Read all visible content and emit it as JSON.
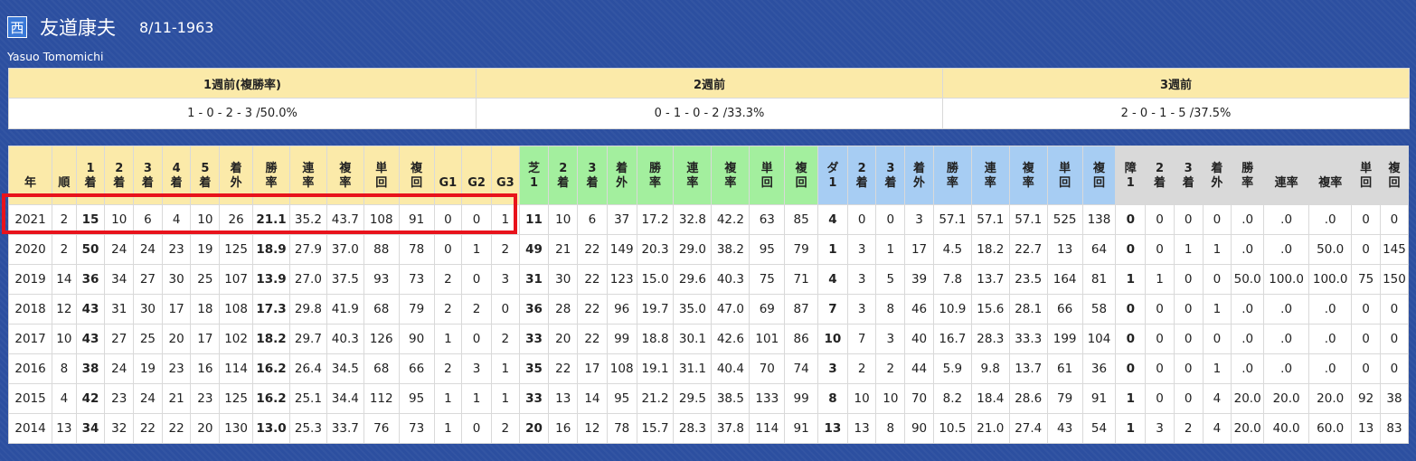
{
  "header": {
    "region_badge": "西",
    "name_jp": "友道康夫",
    "birthdate": "8/11-1963",
    "name_en": "Yasuo Tomomichi"
  },
  "recent": {
    "headers": [
      "1週前(複勝率)",
      "2週前",
      "3週前"
    ],
    "values": [
      "1 - 0 - 2 - 3 /50.0%",
      "0 - 1 - 0 - 2 /33.3%",
      "2 - 0 - 1 - 5 /37.5%"
    ]
  },
  "colors": {
    "background": "#2c4fa0",
    "header_yellow": "#fbeaa9",
    "turf_green": "#a3ef9e",
    "dirt_blue": "#a7cdf3",
    "jump_gray": "#d9d9d9",
    "highlight_red": "#e8131c"
  },
  "stats": {
    "columns": [
      {
        "l1": "",
        "l2": "年"
      },
      {
        "l1": "",
        "l2": "順"
      },
      {
        "l1": "1",
        "l2": "着"
      },
      {
        "l1": "2",
        "l2": "着"
      },
      {
        "l1": "3",
        "l2": "着"
      },
      {
        "l1": "4",
        "l2": "着"
      },
      {
        "l1": "5",
        "l2": "着"
      },
      {
        "l1": "着",
        "l2": "外"
      },
      {
        "l1": "勝",
        "l2": "率"
      },
      {
        "l1": "連",
        "l2": "率"
      },
      {
        "l1": "複",
        "l2": "率"
      },
      {
        "l1": "単",
        "l2": "回"
      },
      {
        "l1": "複",
        "l2": "回"
      },
      {
        "l1": "",
        "l2": "G1"
      },
      {
        "l1": "",
        "l2": "G2"
      },
      {
        "l1": "",
        "l2": "G3"
      },
      {
        "l1": "芝",
        "l2": "1"
      },
      {
        "l1": "2",
        "l2": "着"
      },
      {
        "l1": "3",
        "l2": "着"
      },
      {
        "l1": "着",
        "l2": "外"
      },
      {
        "l1": "勝",
        "l2": "率"
      },
      {
        "l1": "連",
        "l2": "率"
      },
      {
        "l1": "複",
        "l2": "率"
      },
      {
        "l1": "単",
        "l2": "回"
      },
      {
        "l1": "複",
        "l2": "回"
      },
      {
        "l1": "ダ",
        "l2": "1"
      },
      {
        "l1": "2",
        "l2": "着"
      },
      {
        "l1": "3",
        "l2": "着"
      },
      {
        "l1": "着",
        "l2": "外"
      },
      {
        "l1": "勝",
        "l2": "率"
      },
      {
        "l1": "連",
        "l2": "率"
      },
      {
        "l1": "複",
        "l2": "率"
      },
      {
        "l1": "単",
        "l2": "回"
      },
      {
        "l1": "複",
        "l2": "回"
      },
      {
        "l1": "障",
        "l2": "1"
      },
      {
        "l1": "2",
        "l2": "着"
      },
      {
        "l1": "3",
        "l2": "着"
      },
      {
        "l1": "着",
        "l2": "外"
      },
      {
        "l1": "勝",
        "l2": "率"
      },
      {
        "l1": "",
        "l2": "連率"
      },
      {
        "l1": "",
        "l2": "複率"
      },
      {
        "l1": "単",
        "l2": "回"
      },
      {
        "l1": "複",
        "l2": "回"
      }
    ],
    "rows": [
      [
        "2021",
        "2",
        "15",
        "10",
        "6",
        "4",
        "10",
        "26",
        "21.1",
        "35.2",
        "43.7",
        "108",
        "91",
        "0",
        "0",
        "1",
        "11",
        "10",
        "6",
        "37",
        "17.2",
        "32.8",
        "42.2",
        "63",
        "85",
        "4",
        "0",
        "0",
        "3",
        "57.1",
        "57.1",
        "57.1",
        "525",
        "138",
        "0",
        "0",
        "0",
        "0",
        ".0",
        ".0",
        ".0",
        "0",
        "0"
      ],
      [
        "2020",
        "2",
        "50",
        "24",
        "24",
        "23",
        "19",
        "125",
        "18.9",
        "27.9",
        "37.0",
        "88",
        "78",
        "0",
        "1",
        "2",
        "49",
        "21",
        "22",
        "149",
        "20.3",
        "29.0",
        "38.2",
        "95",
        "79",
        "1",
        "3",
        "1",
        "17",
        "4.5",
        "18.2",
        "22.7",
        "13",
        "64",
        "0",
        "0",
        "1",
        "1",
        ".0",
        ".0",
        "50.0",
        "0",
        "145"
      ],
      [
        "2019",
        "14",
        "36",
        "34",
        "27",
        "30",
        "25",
        "107",
        "13.9",
        "27.0",
        "37.5",
        "93",
        "73",
        "2",
        "0",
        "3",
        "31",
        "30",
        "22",
        "123",
        "15.0",
        "29.6",
        "40.3",
        "75",
        "71",
        "4",
        "3",
        "5",
        "39",
        "7.8",
        "13.7",
        "23.5",
        "164",
        "81",
        "1",
        "1",
        "0",
        "0",
        "50.0",
        "100.0",
        "100.0",
        "75",
        "150"
      ],
      [
        "2018",
        "12",
        "43",
        "31",
        "30",
        "17",
        "18",
        "108",
        "17.3",
        "29.8",
        "41.9",
        "68",
        "79",
        "2",
        "2",
        "0",
        "36",
        "28",
        "22",
        "96",
        "19.7",
        "35.0",
        "47.0",
        "69",
        "87",
        "7",
        "3",
        "8",
        "46",
        "10.9",
        "15.6",
        "28.1",
        "66",
        "58",
        "0",
        "0",
        "0",
        "1",
        ".0",
        ".0",
        ".0",
        "0",
        "0"
      ],
      [
        "2017",
        "10",
        "43",
        "27",
        "25",
        "20",
        "17",
        "102",
        "18.2",
        "29.7",
        "40.3",
        "126",
        "90",
        "1",
        "0",
        "2",
        "33",
        "20",
        "22",
        "99",
        "18.8",
        "30.1",
        "42.6",
        "101",
        "86",
        "10",
        "7",
        "3",
        "40",
        "16.7",
        "28.3",
        "33.3",
        "199",
        "104",
        "0",
        "0",
        "0",
        "0",
        ".0",
        ".0",
        ".0",
        "0",
        "0"
      ],
      [
        "2016",
        "8",
        "38",
        "24",
        "19",
        "23",
        "16",
        "114",
        "16.2",
        "26.4",
        "34.5",
        "68",
        "66",
        "2",
        "3",
        "1",
        "35",
        "22",
        "17",
        "108",
        "19.1",
        "31.1",
        "40.4",
        "70",
        "74",
        "3",
        "2",
        "2",
        "44",
        "5.9",
        "9.8",
        "13.7",
        "61",
        "36",
        "0",
        "0",
        "0",
        "1",
        ".0",
        ".0",
        ".0",
        "0",
        "0"
      ],
      [
        "2015",
        "4",
        "42",
        "23",
        "24",
        "21",
        "23",
        "125",
        "16.2",
        "25.1",
        "34.4",
        "112",
        "95",
        "1",
        "1",
        "1",
        "33",
        "13",
        "14",
        "95",
        "21.2",
        "29.5",
        "38.5",
        "133",
        "99",
        "8",
        "10",
        "10",
        "70",
        "8.2",
        "18.4",
        "28.6",
        "79",
        "91",
        "1",
        "0",
        "0",
        "4",
        "20.0",
        "20.0",
        "20.0",
        "92",
        "38"
      ],
      [
        "2014",
        "13",
        "34",
        "32",
        "22",
        "22",
        "20",
        "130",
        "13.0",
        "25.3",
        "33.7",
        "76",
        "73",
        "1",
        "0",
        "2",
        "20",
        "16",
        "12",
        "78",
        "15.7",
        "28.3",
        "37.8",
        "114",
        "91",
        "13",
        "13",
        "8",
        "90",
        "10.5",
        "21.0",
        "27.4",
        "43",
        "54",
        "1",
        "3",
        "2",
        "4",
        "20.0",
        "40.0",
        "60.0",
        "13",
        "83"
      ]
    ]
  }
}
